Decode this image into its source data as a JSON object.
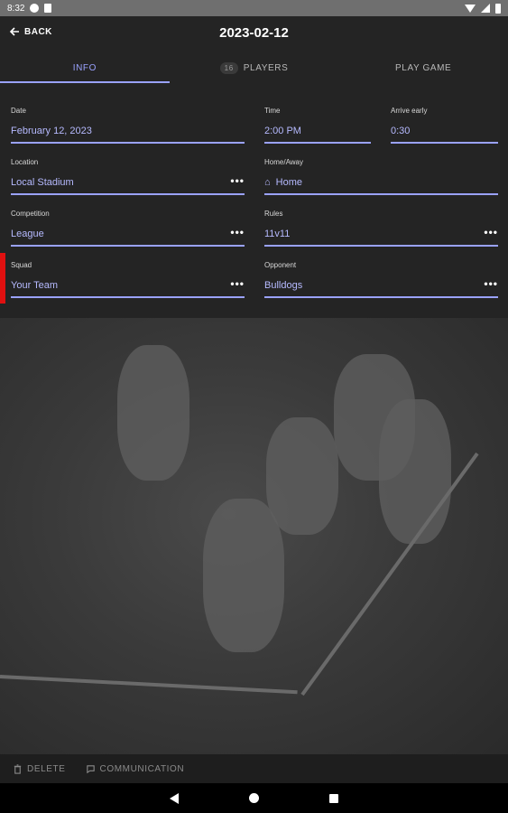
{
  "statusbar": {
    "time": "8:32"
  },
  "header": {
    "back_label": "BACK",
    "title": "2023-02-12"
  },
  "tabs": [
    {
      "label": "INFO",
      "badge": ""
    },
    {
      "label": "PLAYERS",
      "badge": "16"
    },
    {
      "label": "PLAY GAME",
      "badge": ""
    }
  ],
  "fields": {
    "date": {
      "label": "Date",
      "value": "February 12, 2023"
    },
    "time": {
      "label": "Time",
      "value": "2:00 PM"
    },
    "arrive": {
      "label": "Arrive early",
      "value": "0:30"
    },
    "location": {
      "label": "Location",
      "value": "Local Stadium"
    },
    "home_away": {
      "label": "Home/Away",
      "value": "Home"
    },
    "competition": {
      "label": "Competition",
      "value": "League"
    },
    "rules": {
      "label": "Rules",
      "value": "11v11"
    },
    "squad": {
      "label": "Squad",
      "value": "Your Team"
    },
    "opponent": {
      "label": "Opponent",
      "value": "Bulldogs"
    }
  },
  "more_glyph": "•••",
  "bottom_actions": {
    "delete": "DELETE",
    "communication": "COMMUNICATION"
  },
  "colors": {
    "accent": "#9aa2ff",
    "value_text": "#b6baff",
    "marker": "#e01010",
    "surface": "#242424"
  }
}
